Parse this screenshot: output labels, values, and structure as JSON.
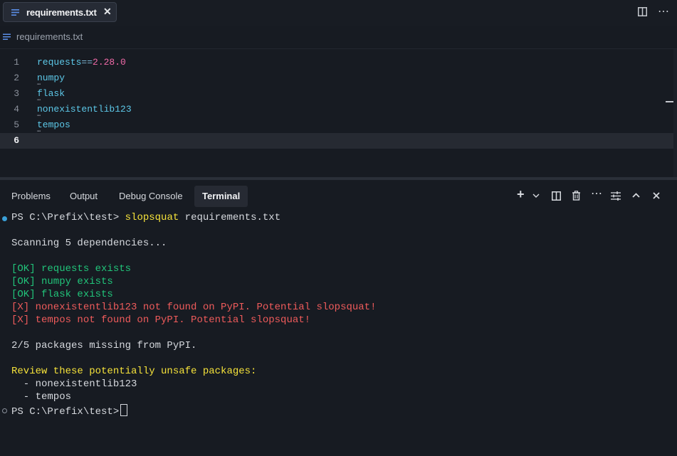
{
  "tab": {
    "title": "requirements.txt",
    "close_glyph": "✕"
  },
  "title_actions": {
    "split_glyph": "◫",
    "more_glyph": "⋯"
  },
  "breadcrumb": {
    "file": "requirements.txt"
  },
  "editor": {
    "lines": [
      {
        "num": "1",
        "pkg": "requests",
        "op": "==",
        "ver": "2.28.0"
      },
      {
        "num": "2",
        "pkg": "numpy"
      },
      {
        "num": "3",
        "pkg": "flask"
      },
      {
        "num": "4",
        "pkg": "nonexistentlib123"
      },
      {
        "num": "5",
        "pkg": "tempos"
      },
      {
        "num": "6",
        "pkg": ""
      }
    ],
    "hint_dots": "⋯"
  },
  "panel": {
    "tabs": [
      "Problems",
      "Output",
      "Debug Console",
      "Terminal"
    ],
    "active_tab": "Terminal",
    "actions": {
      "add": "+",
      "dropdown": "⌄",
      "split": "◫",
      "trash": "🗑",
      "more": "⋯",
      "settings": "☰",
      "maximize": "^",
      "close": "✕"
    }
  },
  "terminal": {
    "prompt": "PS C:\\Prefix\\test> ",
    "command": "slopsquat",
    "command_arg": " requirements.txt",
    "scanning": "Scanning 5 dependencies...",
    "ok_lines": [
      "[OK] requests exists",
      "[OK] numpy exists",
      "[OK] flask exists"
    ],
    "fail_lines": [
      "[X] nonexistentlib123 not found on PyPI. Potential slopsquat!",
      "[X] tempos not found on PyPI. Potential slopsquat!"
    ],
    "summary": "2/5 packages missing from PyPI.",
    "review_heading": "Review these potentially unsafe packages:",
    "unsafe": [
      "  - nonexistentlib123",
      "  - tempos"
    ],
    "final_prompt": "PS C:\\Prefix\\test>"
  },
  "colors": {
    "ok": "#21c47a",
    "fail": "#ef5b5b",
    "warn": "#f5e23a",
    "key": "#5dc8e8",
    "number": "#f06aa8"
  }
}
